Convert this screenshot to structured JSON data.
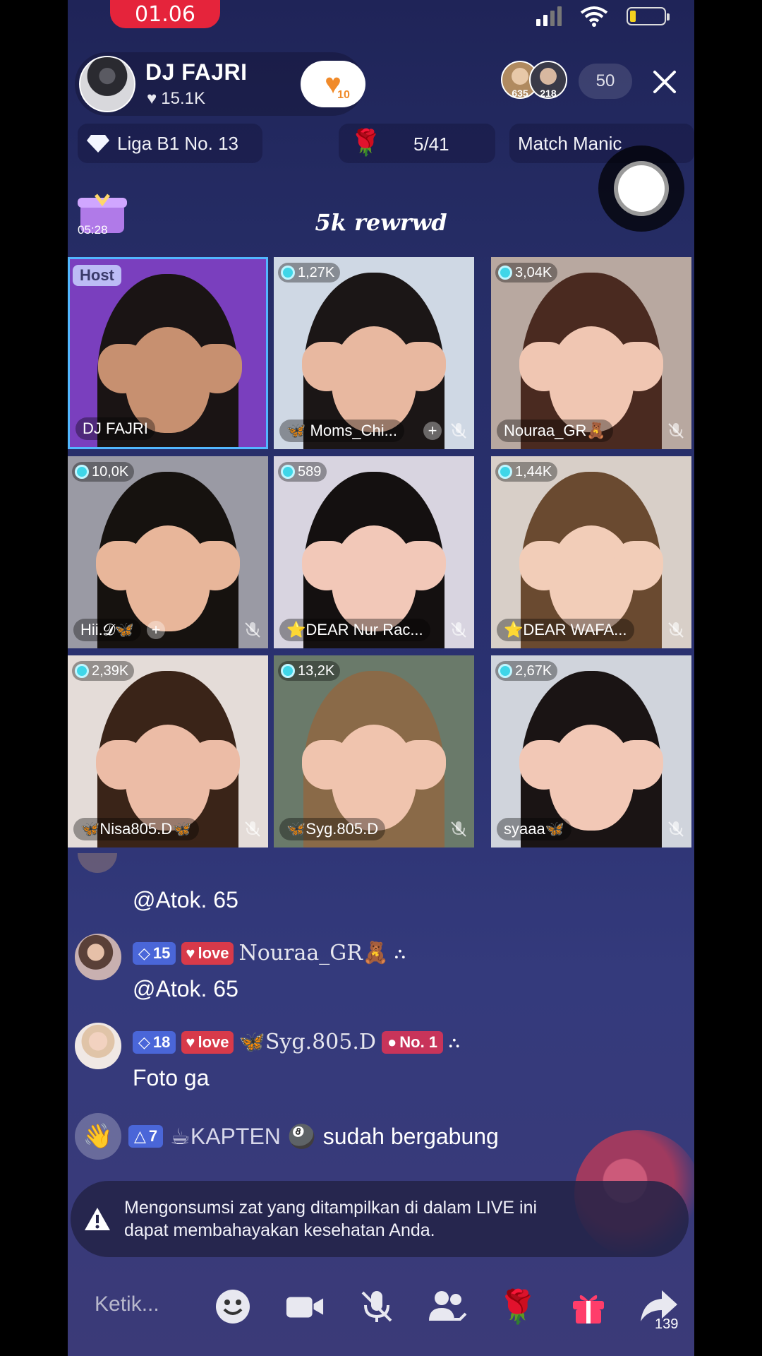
{
  "status": {
    "time": "01.06"
  },
  "host": {
    "name": "DJ FAJRI",
    "likes": "15.1K",
    "heart_level": "10"
  },
  "viewers": {
    "avatars": [
      {
        "label": "635"
      },
      {
        "label": "218"
      }
    ],
    "count": "50"
  },
  "league": {
    "label": "Liga B1 No. 13"
  },
  "rose_goal": {
    "progress": "5/41"
  },
  "match": {
    "label": "Match Manic"
  },
  "gift_timer": "05:28",
  "banner": "5k rewrwd",
  "grid": {
    "host_tag": "Host",
    "tiles": [
      {
        "name": "DJ FAJRI",
        "host": true,
        "score": "",
        "plus": false,
        "mute": false,
        "skin": "#c79070",
        "hair": "#1a1414",
        "bg": "#7a3fbe"
      },
      {
        "name": "🦋 Moms_Chi...",
        "score": "1,27K",
        "plus": true,
        "mute": true,
        "skin": "#e8b8a0",
        "hair": "#1b1616",
        "bg": "#cfd8e4"
      },
      {
        "name": "Nouraa_GR🧸",
        "score": "3,04K",
        "plus": false,
        "mute": true,
        "skin": "#f0c6b2",
        "hair": "#4a2a20",
        "bg": "#b8a8a0"
      },
      {
        "name": "Hii.𝓓🦋",
        "score": "10,0K",
        "plus": true,
        "mute": true,
        "skin": "#e8b69a",
        "hair": "#16120f",
        "bg": "#9a9aa4"
      },
      {
        "name": "⭐DEAR Nur Rac...",
        "score": "589",
        "plus": false,
        "mute": true,
        "skin": "#f2c8b8",
        "hair": "#141010",
        "bg": "#d8d4e0"
      },
      {
        "name": "⭐DEAR WAFA...",
        "score": "1,44K",
        "plus": false,
        "mute": true,
        "skin": "#f2cdb8",
        "hair": "#6a4a30",
        "bg": "#d8cfc8"
      },
      {
        "name": "🦋Nisa805.D🦋",
        "score": "2,39K",
        "plus": false,
        "mute": true,
        "skin": "#ecbca6",
        "hair": "#3a2418",
        "bg": "#e4dcd8"
      },
      {
        "name": "🦋Syg.805.D",
        "score": "13,2K",
        "plus": false,
        "mute": true,
        "skin": "#f0c4ae",
        "hair": "#8a6a48",
        "bg": "#6a7a6a"
      },
      {
        "name": "syaaa🦋",
        "score": "2,67K",
        "plus": false,
        "mute": true,
        "skin": "#f2c8b6",
        "hair": "#1a1414",
        "bg": "#d0d4dc"
      }
    ]
  },
  "chat": {
    "messages": [
      {
        "text": "@Atok. 65"
      },
      {
        "level": "15",
        "love": "love",
        "user": "Nouraa_GR🧸",
        "text": "@Atok. 65"
      },
      {
        "level": "18",
        "love": "love",
        "user": "🦋Syg.805.D",
        "rank": "No. 1",
        "text": "Foto ga"
      }
    ],
    "join": {
      "level": "7",
      "user": "☕KAPTEN",
      "emoji": "🎱",
      "text": "sudah bergabung"
    }
  },
  "warning": {
    "line1": "Mengonsumsi zat yang ditampilkan di dalam LIVE ini",
    "line2": "dapat membahayakan kesehatan Anda."
  },
  "bottom": {
    "placeholder": "Ketik...",
    "share_count": "139"
  },
  "colors": {
    "accent_red": "#e5243b",
    "level_blue": "#4a66d8",
    "love_red": "#d83a4a",
    "diamond": "#3fd6e8"
  },
  "icons": [
    "signal-icon",
    "wifi-icon",
    "battery-icon",
    "heart-icon",
    "close-icon",
    "diamond-icon",
    "rose-icon",
    "record-icon",
    "emoji-icon",
    "camera-icon",
    "mic-off-icon",
    "people-icon",
    "gift-icon",
    "share-icon",
    "warning-icon"
  ]
}
